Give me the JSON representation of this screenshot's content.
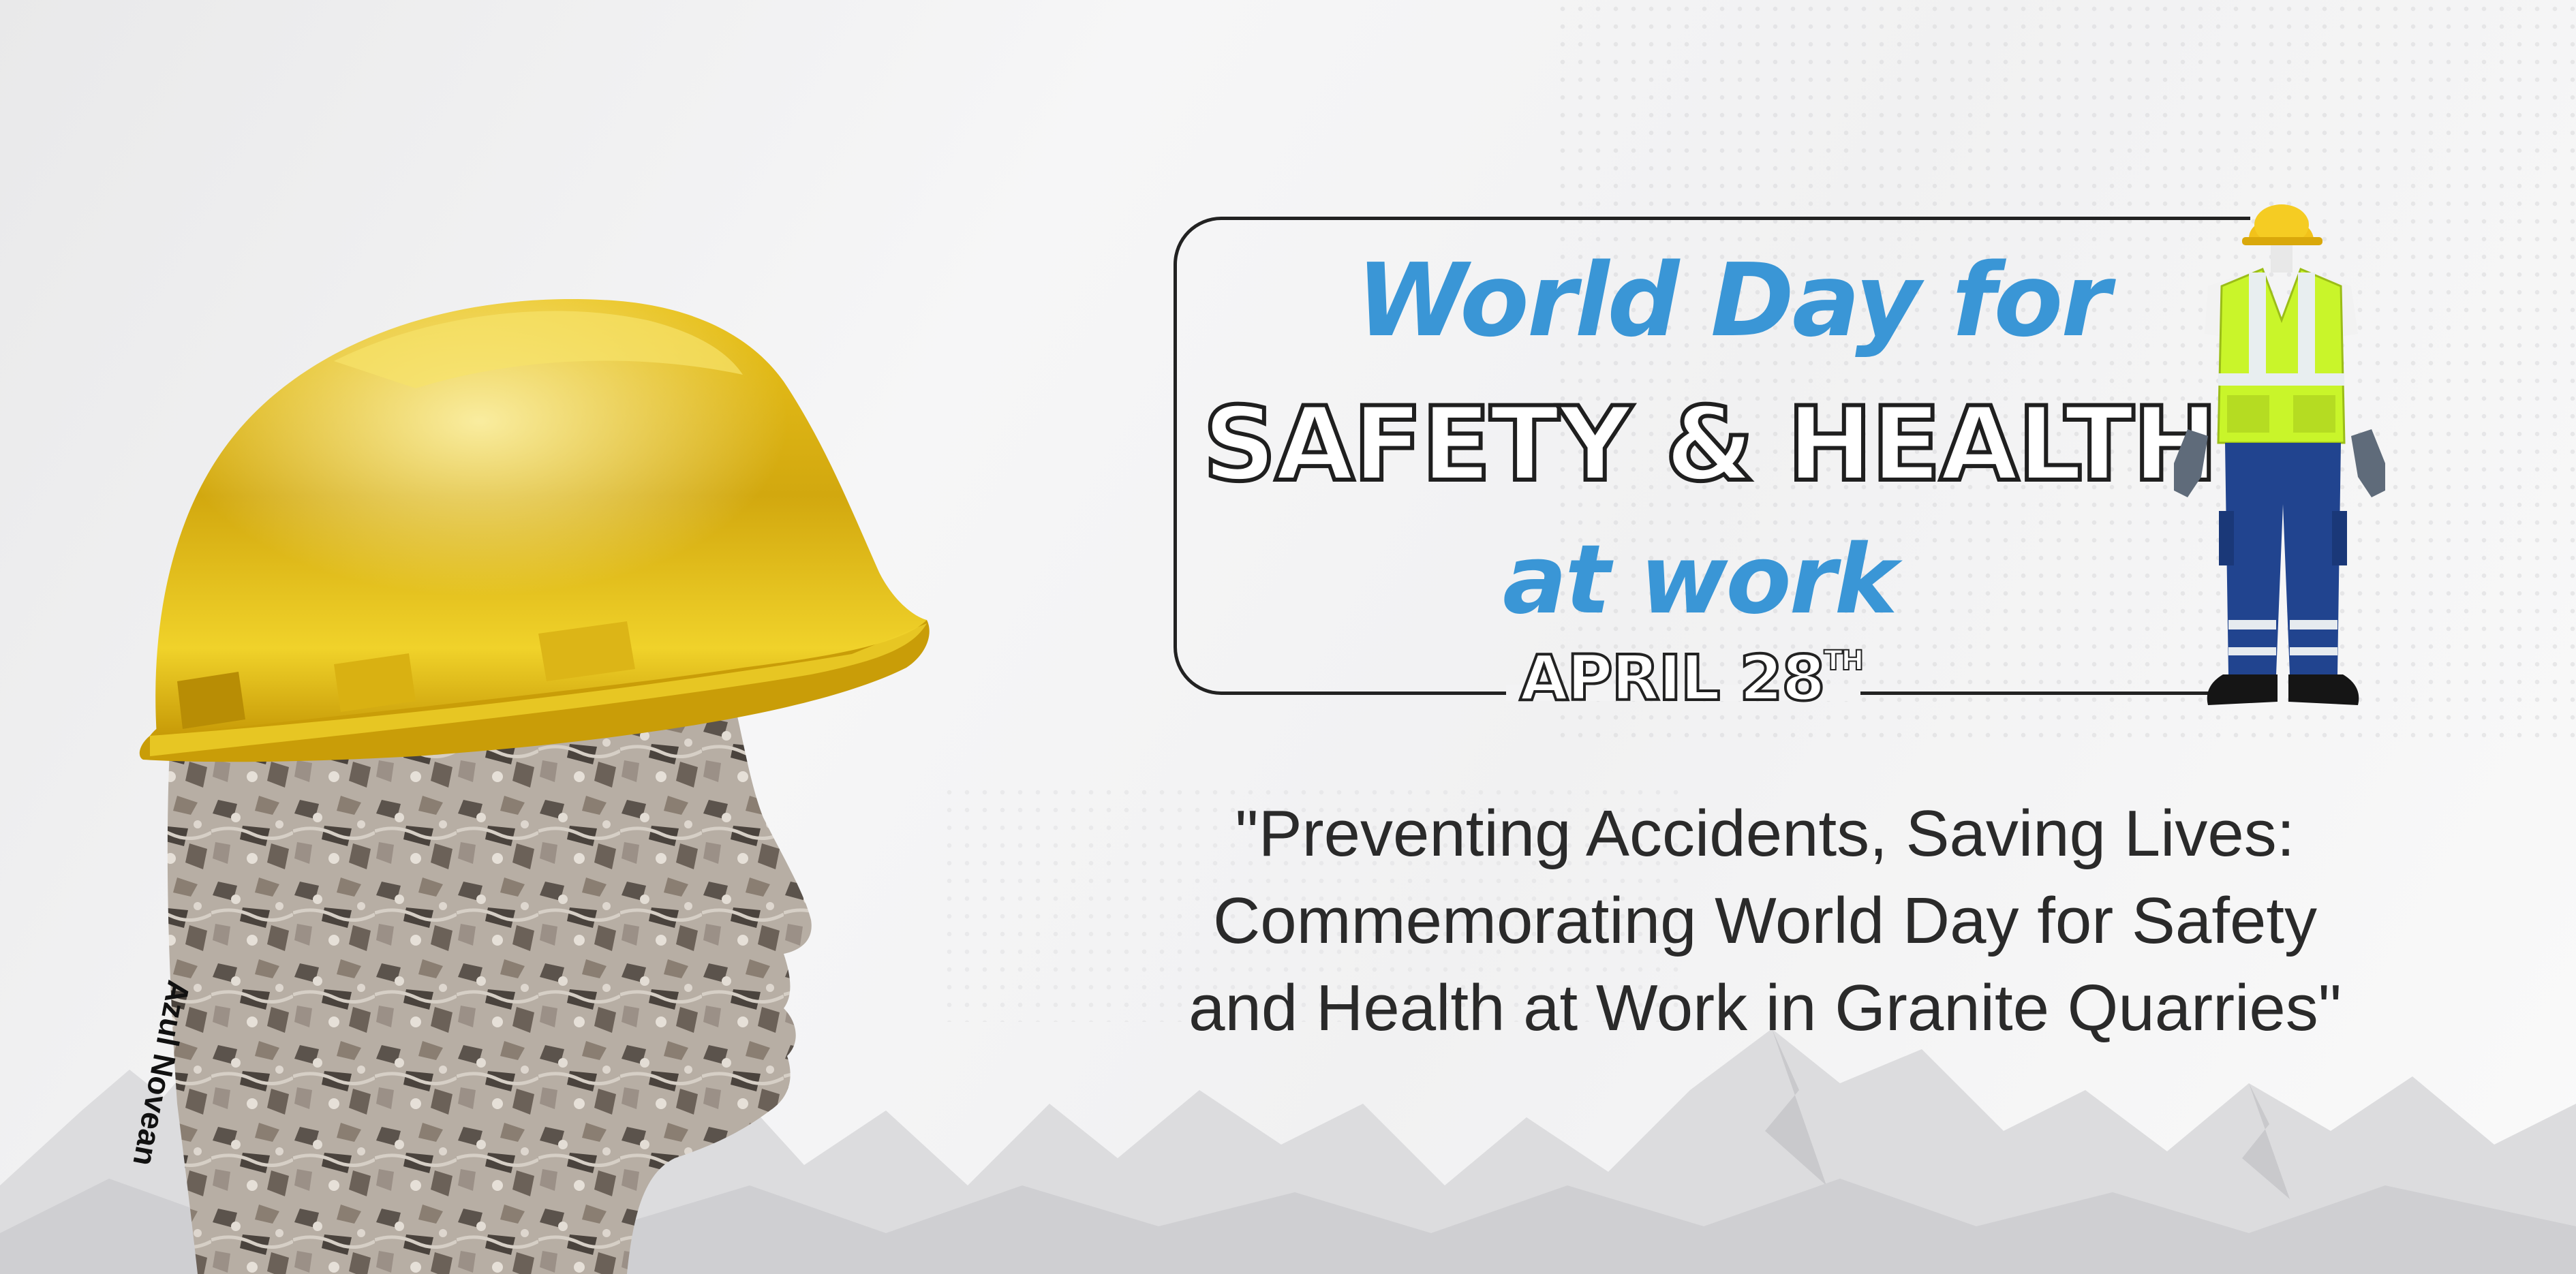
{
  "colors": {
    "accent_blue": "#3a96d6",
    "helmet_yellow": "#f2cc1c",
    "vest_green": "#c9f52a",
    "trouser_blue": "#21448f",
    "text_dark": "#2a2a2a"
  },
  "title": {
    "line1": "World Day for",
    "line2": "SAFETY &  HEALTH",
    "line3": "at work"
  },
  "date": {
    "main": "APRIL 28",
    "suffix": "TH"
  },
  "quote": {
    "lines": [
      "\"Preventing Accidents, Saving Lives:",
      "Commemorating World Day for Safety",
      "and Health at Work in Granite Quarries\""
    ]
  },
  "credit": "Azul Novean",
  "icons": {
    "helmet": "hard-hat-icon",
    "worker": "safety-uniform-icon",
    "mountains": "mountain-range-icon",
    "head": "granite-head-silhouette-icon"
  }
}
